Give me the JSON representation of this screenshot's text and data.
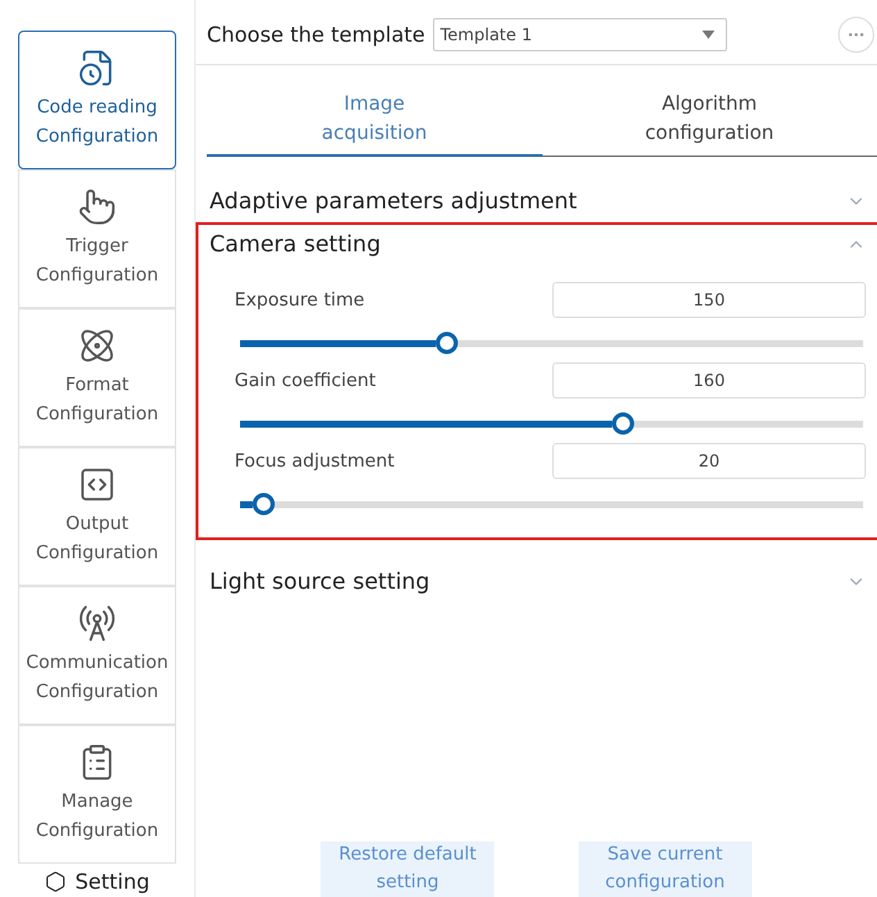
{
  "sidebar": {
    "items": [
      {
        "label": "Code reading Configuration",
        "kind": "code",
        "selected": true
      },
      {
        "label": "Trigger Configuration",
        "kind": "trigger",
        "selected": false
      },
      {
        "label": "Format Configuration",
        "kind": "format",
        "selected": false
      },
      {
        "label": "Output Configuration",
        "kind": "output",
        "selected": false
      },
      {
        "label": "Communication Configuration",
        "kind": "communication",
        "selected": false
      },
      {
        "label": "Manage Configuration",
        "kind": "manage",
        "selected": false
      }
    ],
    "footer": "Setting"
  },
  "template": {
    "label": "Choose the template",
    "value": "Template 1"
  },
  "tabs": [
    {
      "label": "Image acquisition",
      "selected": true
    },
    {
      "label": "Algorithm configuration",
      "selected": false
    }
  ],
  "sections": [
    {
      "title": "Adaptive parameters adjustment",
      "expanded": false,
      "highlighted": false
    },
    {
      "title": "Camera setting",
      "expanded": true,
      "highlighted": true,
      "params": [
        {
          "label": "Exposure time",
          "value": "150",
          "level": 0.325
        },
        {
          "label": "Gain coefficient",
          "value": "160",
          "level": 0.62
        },
        {
          "label": "Focus adjustment",
          "value": "20",
          "level": 0.02
        }
      ]
    },
    {
      "title": "Light source setting",
      "expanded": false,
      "highlighted": false
    }
  ],
  "buttons": [
    "Restore default setting",
    "Save current configuration"
  ]
}
